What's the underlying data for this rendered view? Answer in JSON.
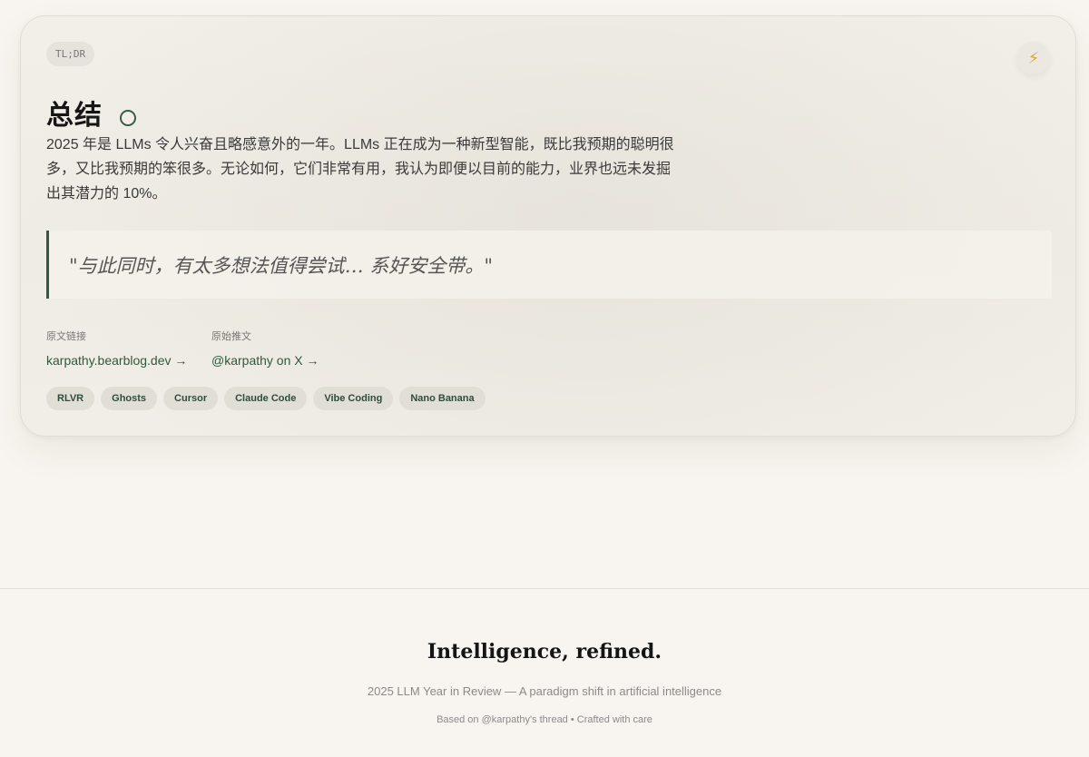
{
  "card": {
    "badge": "TL;DR",
    "icon": "lightning-bolt-icon",
    "title": "总结",
    "summary": "2025 年是 LLMs 令人兴奋且略感意外的一年。LLMs 正在成为一种新型智能，既比我预期的聪明很多，又比我预期的笨很多。无论如何，它们非常有用，我认为即便以目前的能力，业界也远未发掘出其潜力的 10%。",
    "quote": "\"与此同时，有太多想法值得尝试… 系好安全带。\"",
    "links": [
      {
        "label": "原文链接",
        "text": "karpathy.bearblog.dev →"
      },
      {
        "label": "原始推文",
        "text": "@karpathy on X →"
      }
    ],
    "tags": [
      "RLVR",
      "Ghosts",
      "Cursor",
      "Claude Code",
      "Vibe Coding",
      "Nano Banana"
    ]
  },
  "footer": {
    "title": "Intelligence, refined.",
    "subtitle": "2025 LLM Year in Review — A paradigm shift in artificial intelligence",
    "credit": "Based on @karpathy's thread • Crafted with care"
  },
  "colors": {
    "background": "#f8f5f0",
    "accent_green": "#2c5a3a",
    "bolt": "#e0a52a"
  }
}
